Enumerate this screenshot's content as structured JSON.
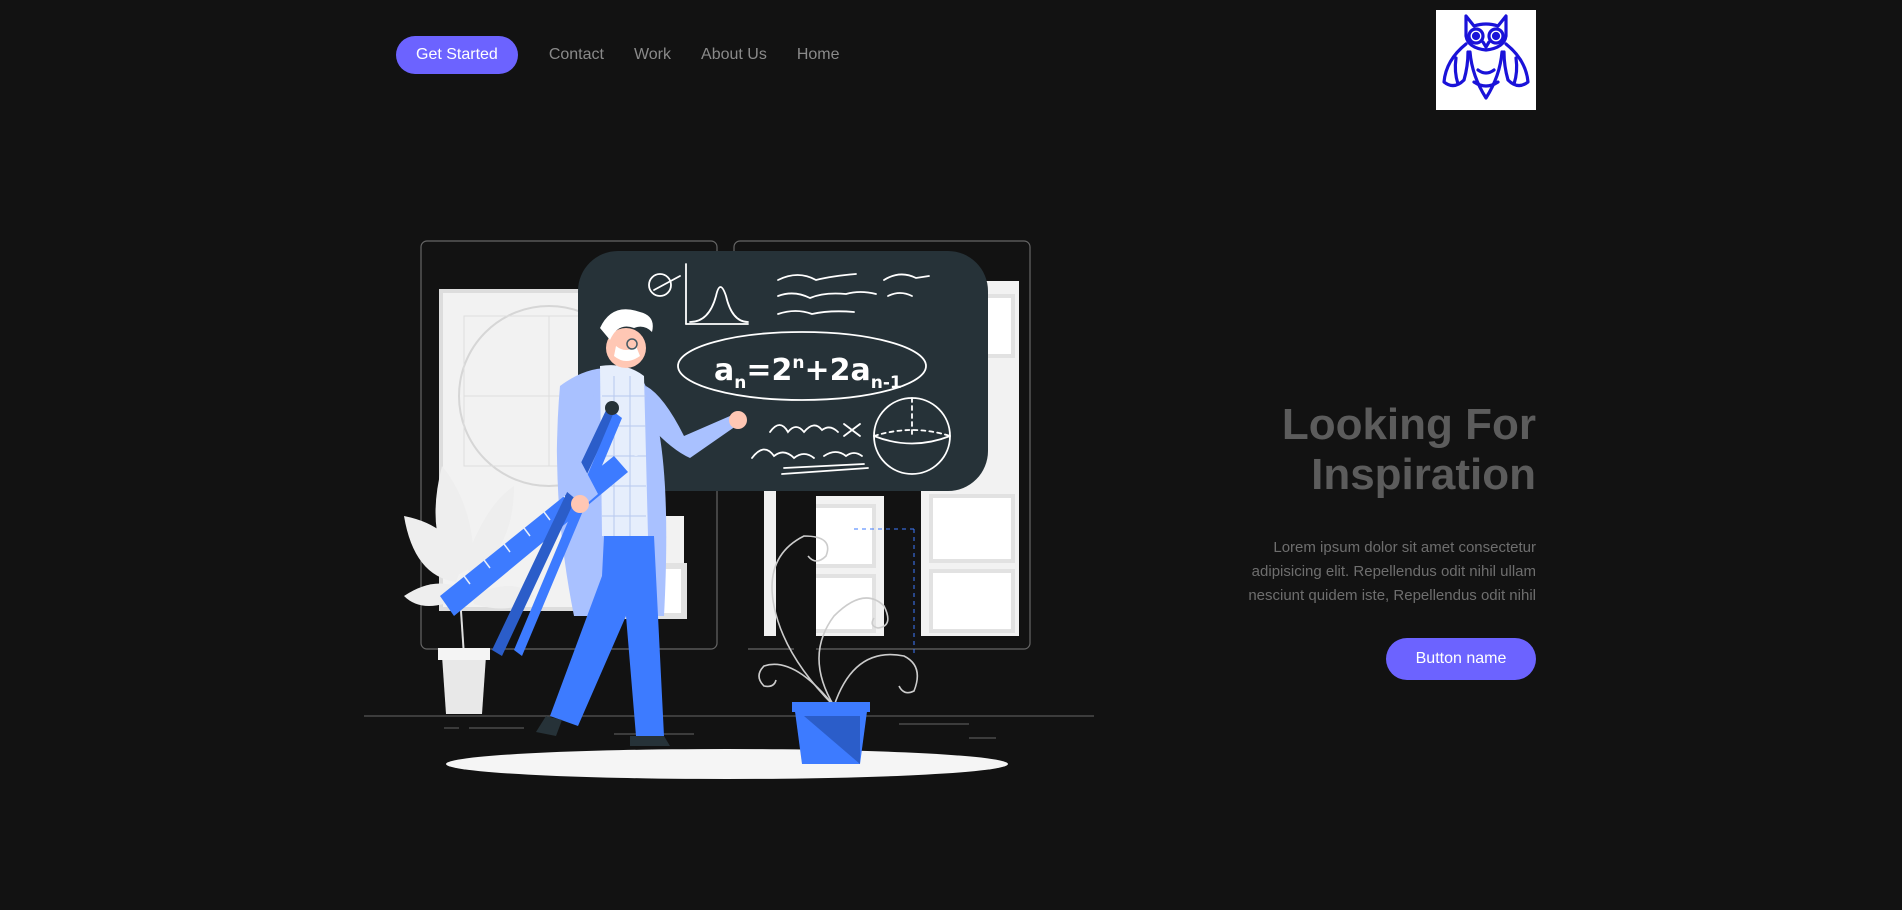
{
  "nav": {
    "cta_label": "Get Started",
    "links": [
      "Contact",
      "Work",
      "About Us",
      "Home"
    ]
  },
  "logo": {
    "icon": "owl-icon",
    "color": "#1a12d9"
  },
  "illustration": {
    "icon": "teacher-chalkboard-illustration",
    "formula_base": "a",
    "formula_sub": "n",
    "formula_eq": "=2",
    "formula_sup": "n",
    "formula_plus": "+2a",
    "formula_sub2": "n-1"
  },
  "hero": {
    "title_line1": "Looking For",
    "title_line2": "Inspiration",
    "body": "Lorem ipsum dolor sit amet consectetur adipisicing elit. Repellendus odit nihil ullam nesciunt quidem iste, Repellendus odit nihil",
    "button_label": "Button name"
  },
  "colors": {
    "background": "#121212",
    "accent": "#6c63ff",
    "illustration_blue": "#3d7bff",
    "chalkboard": "#263238"
  }
}
